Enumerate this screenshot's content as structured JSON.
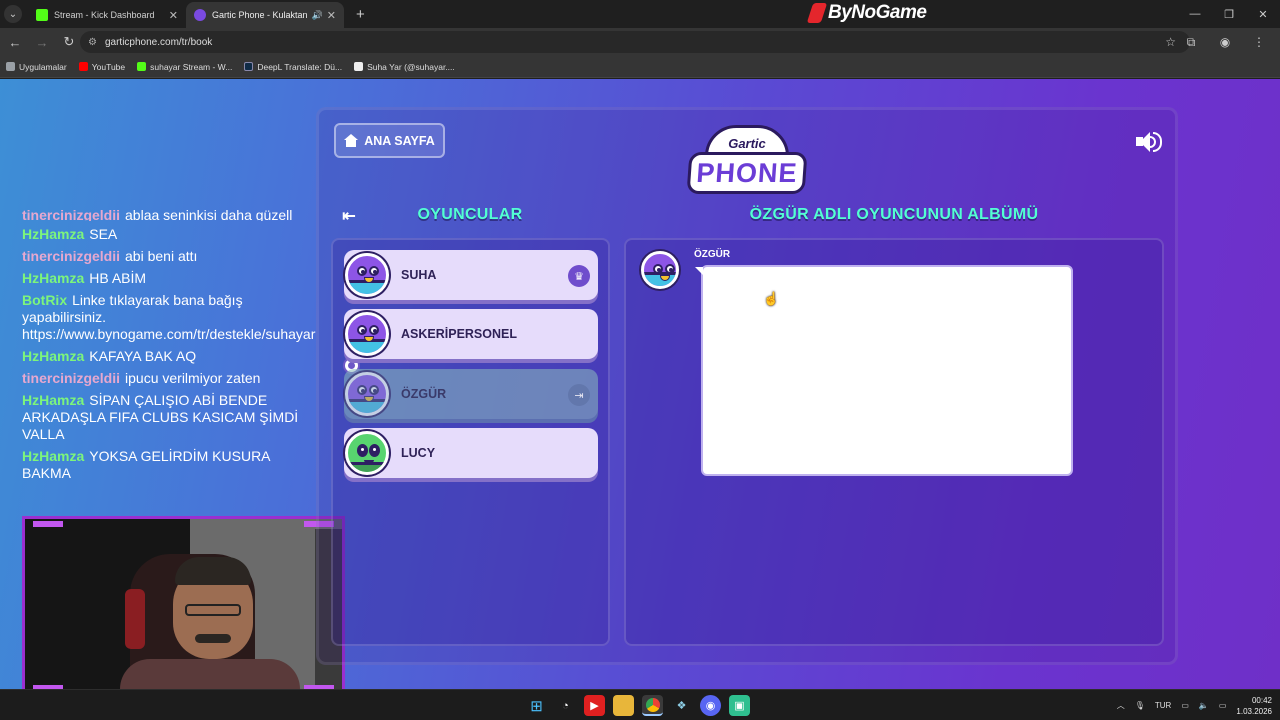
{
  "browser": {
    "tabs": [
      {
        "title": "Stream - Kick Dashboard",
        "favicon_color": "#53fc18"
      },
      {
        "title": "Gartic Phone - Kulaktan Kul",
        "favicon_color": "#7a4ae0"
      }
    ],
    "new_tab_icon": "plus-icon",
    "brand": "ByNoGame",
    "url": "garticphone.com/tr/book",
    "bookmarks": [
      {
        "label": "Uygulamalar",
        "color": "#9aa0a6"
      },
      {
        "label": "YouTube",
        "color": "#ff0000"
      },
      {
        "label": "suhayar Stream - W...",
        "color": "#53fc18"
      },
      {
        "label": "DeepL Translate: Dü...",
        "color": "#0f2b46"
      },
      {
        "label": "Suha Yar (@suhayar....",
        "color": "#eeeeee"
      }
    ]
  },
  "chat": {
    "messages": [
      {
        "user": "tinercinizgeldii",
        "color": "#e6a8cf",
        "text": "ablaa seninkisi daha güzell"
      },
      {
        "user": "HzHamza",
        "color": "#7cf57c",
        "text": "SEA"
      },
      {
        "user": "tinercinizgeldii",
        "color": "#e6a8cf",
        "text": "abi beni attı"
      },
      {
        "user": "HzHamza",
        "color": "#7cf57c",
        "text": "HB ABİM"
      },
      {
        "user": "BotRix",
        "color": "#7cf57c",
        "text": "Linke tıklayarak bana bağış yapabilirsiniz. https://www.bynogame.com/tr/destekle/suhayar"
      },
      {
        "user": "HzHamza",
        "color": "#7cf57c",
        "text": "KAFAYA BAK AQ"
      },
      {
        "user": "tinercinizgeldii",
        "color": "#e6a8cf",
        "text": "ipucu verilmiyor zaten"
      },
      {
        "user": "HzHamza",
        "color": "#7cf57c",
        "text": "SİPAN ÇALIŞIO ABİ BENDE ARKADAŞLA FIFA CLUBS KASICAM ŞİMDİ VALLA"
      },
      {
        "user": "HzHamza",
        "color": "#7cf57c",
        "text": "YOKSA GELİRDİM KUSURA BAKMA"
      }
    ]
  },
  "game": {
    "home_button": "ANA SAYFA",
    "logo_top": "Gartic",
    "logo_word": "PHONE",
    "players_title": "OYUNCULAR",
    "album_title": "ÖZGÜR ADLI OYUNCUNUN ALBÜMÜ",
    "players": [
      {
        "name": "SUHA",
        "badge": "crown-icon"
      },
      {
        "name": "ASKERİPERSONEL",
        "badge": ""
      },
      {
        "name": "ÖZGÜR",
        "badge": "exit-icon"
      },
      {
        "name": "LUCY",
        "badge": ""
      }
    ],
    "album": {
      "author": "ÖZGÜR",
      "content": ""
    }
  },
  "taskbar": {
    "language": "TUR",
    "time": "00:42",
    "date": "1.03.2026"
  }
}
